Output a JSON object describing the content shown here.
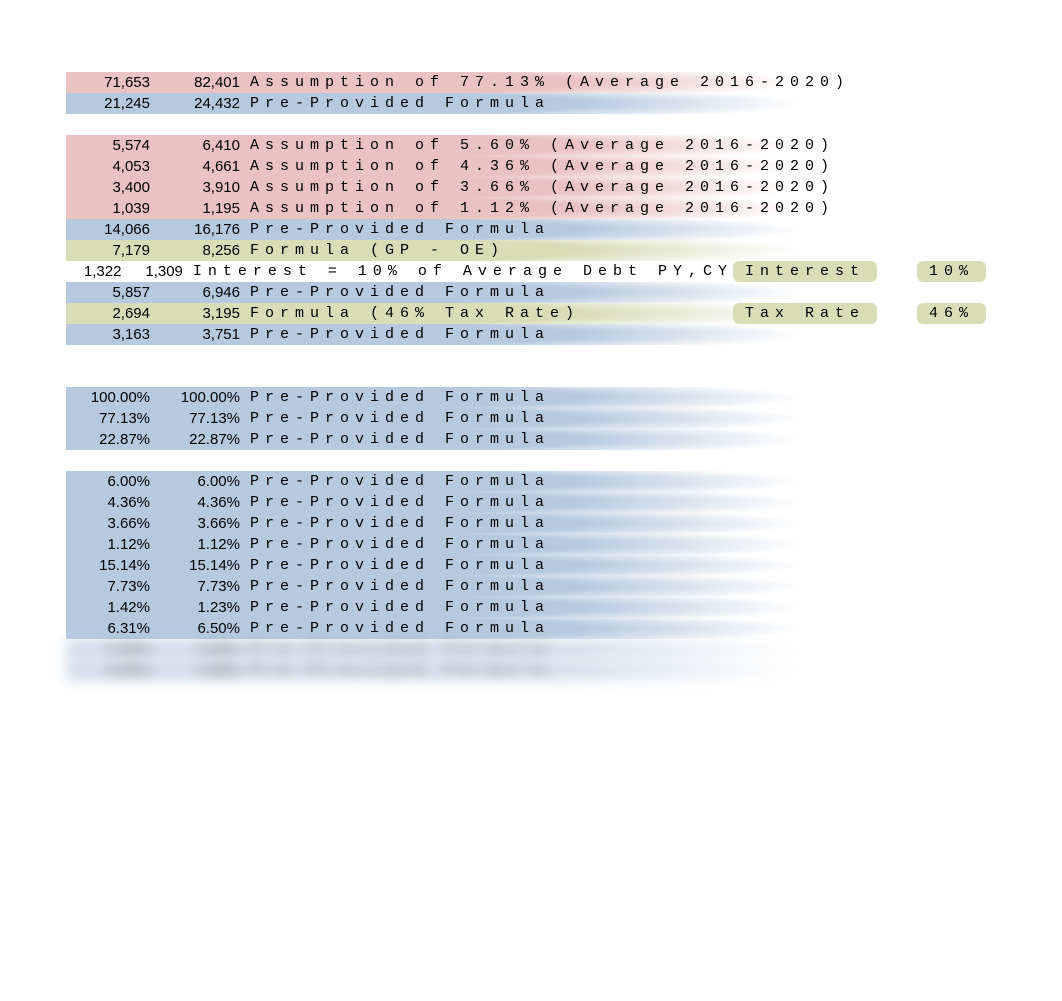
{
  "chart_data": {
    "type": "table",
    "title": "",
    "rows": [
      {
        "a": "71,653",
        "b": "82,401",
        "note": "Assumption of 77.13% (Average 2016-2020)",
        "hl": "red"
      },
      {
        "a": "21,245",
        "b": "24,432",
        "note": "Pre-Provided Formula",
        "hl": "blue"
      },
      {
        "spacer": true
      },
      {
        "a": "5,574",
        "b": "6,410",
        "note": "Assumption of 5.60% (Average 2016-2020)",
        "hl": "red"
      },
      {
        "a": "4,053",
        "b": "4,661",
        "note": "Assumption of 4.36% (Average 2016-2020)",
        "hl": "red"
      },
      {
        "a": "3,400",
        "b": "3,910",
        "note": "Assumption of 3.66% (Average 2016-2020)",
        "hl": "red"
      },
      {
        "a": "1,039",
        "b": "1,195",
        "note": "Assumption of 1.12% (Average 2016-2020)",
        "hl": "red"
      },
      {
        "a": "14,066",
        "b": "16,176",
        "note": "Pre-Provided Formula",
        "hl": "blue"
      },
      {
        "a": "7,179",
        "b": "8,256",
        "note": "Formula (GP - OE)",
        "hl": "olive"
      },
      {
        "a": "1,322",
        "b": "1,309",
        "note": "Interest = 10% of Average Debt PY,CY",
        "hl": "none",
        "side": {
          "label": "Interest",
          "value": "10%"
        }
      },
      {
        "a": "5,857",
        "b": "6,946",
        "note": "Pre-Provided Formula",
        "hl": "blue"
      },
      {
        "a": "2,694",
        "b": "3,195",
        "note": "Formula (46% Tax Rate)",
        "hl": "olive",
        "side": {
          "label": "Tax Rate",
          "value": "46%"
        }
      },
      {
        "a": "3,163",
        "b": "3,751",
        "note": "Pre-Provided Formula",
        "hl": "blue"
      },
      {
        "spacer": true
      },
      {
        "spacer": true
      },
      {
        "a": "100.00%",
        "b": "100.00%",
        "note": "Pre-Provided Formula",
        "hl": "blue"
      },
      {
        "a": "77.13%",
        "b": "77.13%",
        "note": "Pre-Provided Formula",
        "hl": "blue"
      },
      {
        "a": "22.87%",
        "b": "22.87%",
        "note": "Pre-Provided Formula",
        "hl": "blue"
      },
      {
        "spacer": true
      },
      {
        "a": "6.00%",
        "b": "6.00%",
        "note": "Pre-Provided Formula",
        "hl": "blue"
      },
      {
        "a": "4.36%",
        "b": "4.36%",
        "note": "Pre-Provided Formula",
        "hl": "blue"
      },
      {
        "a": "3.66%",
        "b": "3.66%",
        "note": "Pre-Provided Formula",
        "hl": "blue"
      },
      {
        "a": "1.12%",
        "b": "1.12%",
        "note": "Pre-Provided Formula",
        "hl": "blue"
      },
      {
        "a": "15.14%",
        "b": "15.14%",
        "note": "Pre-Provided Formula",
        "hl": "blue"
      },
      {
        "a": "7.73%",
        "b": "7.73%",
        "note": "Pre-Provided Formula",
        "hl": "blue"
      },
      {
        "a": "1.42%",
        "b": "1.23%",
        "note": "Pre-Provided Formula",
        "hl": "blue"
      },
      {
        "a": "6.31%",
        "b": "6.50%",
        "note": "Pre-Provided Formula",
        "hl": "blue"
      },
      {
        "a": "0.00%",
        "b": "0.00%",
        "note": "Pre-Provided Formula",
        "hl": "blue",
        "blur": true
      },
      {
        "a": "0.00%",
        "b": "0.00%",
        "note": "Pre-Provided Formula",
        "hl": "blue",
        "blur": true
      }
    ]
  }
}
